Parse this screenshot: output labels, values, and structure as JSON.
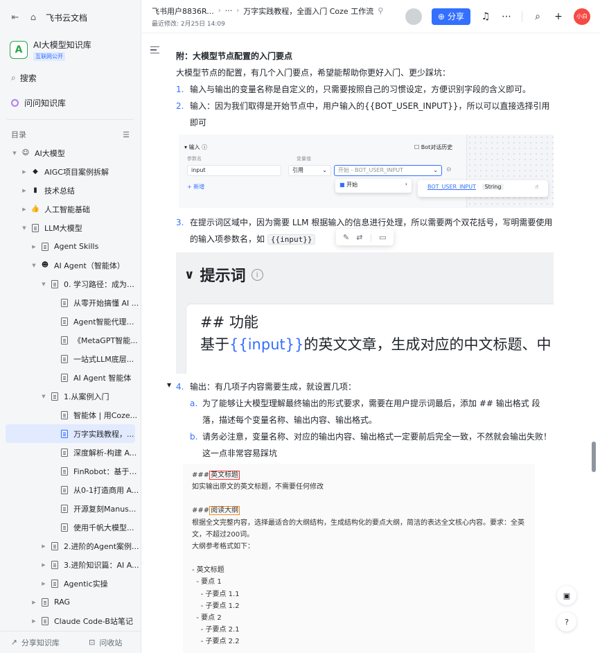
{
  "sidebar": {
    "brand": "飞书云文档",
    "kb_name": "AI大模型知识库",
    "kb_badge": "互联网公开",
    "search": "搜索",
    "ask": "问问知识库",
    "toc_label": "目录",
    "tree": [
      {
        "label": "AI大模型",
        "indent": 0,
        "arrow": "▼",
        "icon": "smile"
      },
      {
        "label": "AIGC项目案例拆解",
        "indent": 1,
        "arrow": "▶",
        "icon": "cube"
      },
      {
        "label": "技术总结",
        "indent": 1,
        "arrow": "▶",
        "icon": "phone"
      },
      {
        "label": "人工智能基础",
        "indent": 1,
        "arrow": "▶",
        "icon": "thumb"
      },
      {
        "label": "LLM大模型",
        "indent": 1,
        "arrow": "▼",
        "icon": "doc"
      },
      {
        "label": "Agent Skills",
        "indent": 2,
        "arrow": "▶",
        "icon": "doc"
      },
      {
        "label": "AI Agent（智能体）",
        "indent": 2,
        "arrow": "▼",
        "icon": "robot"
      },
      {
        "label": "0. 学习路径：成为基...",
        "indent": 3,
        "arrow": "▼",
        "icon": "doc"
      },
      {
        "label": "从零开始搞懂 AI ...",
        "indent": 4,
        "arrow": "",
        "icon": "doc"
      },
      {
        "label": "Agent智能代理开...",
        "indent": 4,
        "arrow": "",
        "icon": "doc"
      },
      {
        "label": "《MetaGPT智能...",
        "indent": 4,
        "arrow": "",
        "icon": "doc"
      },
      {
        "label": "一站式LLM底层...",
        "indent": 4,
        "arrow": "",
        "icon": "doc"
      },
      {
        "label": "AI Agent 智能体",
        "indent": 4,
        "arrow": "",
        "icon": "doc"
      },
      {
        "label": "1.从案例入门",
        "indent": 3,
        "arrow": "▼",
        "icon": "doc"
      },
      {
        "label": "智能体 | 用Coze...",
        "indent": 4,
        "arrow": "",
        "icon": "doc"
      },
      {
        "label": "万字实践教程，...",
        "indent": 4,
        "arrow": "",
        "icon": "doc",
        "active": true
      },
      {
        "label": "深度解析-构建 A...",
        "indent": 4,
        "arrow": "",
        "icon": "doc"
      },
      {
        "label": "FinRobot：基于L...",
        "indent": 4,
        "arrow": "",
        "icon": "doc"
      },
      {
        "label": "从0-1打造商用 A...",
        "indent": 4,
        "arrow": "",
        "icon": "doc"
      },
      {
        "label": "开源复刻Manus...",
        "indent": 4,
        "arrow": "",
        "icon": "doc"
      },
      {
        "label": "使用千帆大模型...",
        "indent": 4,
        "arrow": "",
        "icon": "doc"
      },
      {
        "label": "2.进阶的Agent案例...",
        "indent": 3,
        "arrow": "▶",
        "icon": "doc"
      },
      {
        "label": "3.进阶知识篇：AI A...",
        "indent": 3,
        "arrow": "▶",
        "icon": "doc"
      },
      {
        "label": "Agentic实操",
        "indent": 3,
        "arrow": "▶",
        "icon": "doc"
      },
      {
        "label": "RAG",
        "indent": 2,
        "arrow": "▶",
        "icon": "doc"
      },
      {
        "label": "Claude Code-B站笔记",
        "indent": 2,
        "arrow": "▶",
        "icon": "doc"
      }
    ],
    "bottom_share": "分享知识库",
    "bottom_robot": "问收站"
  },
  "header": {
    "crumb_user": "飞书用户8836R...",
    "crumb_more": "···",
    "crumb_title": "万字实践教程，全面入门 Coze 工作流",
    "last_modified": "最近修改: 2月25日 14:09",
    "share_label": "分享",
    "user_avatar": "小白"
  },
  "doc": {
    "section_title": "附：大模型节点配置的入门要点",
    "intro": "大模型节点的配置，有几个入门要点，希望能帮助你更好入门、更少踩坑：",
    "items": [
      {
        "num": "1.",
        "text": "输入与输出的变量名称是自定义的，只需要按照自己的习惯设定，方便识别字段的含义即可。"
      },
      {
        "num": "2.",
        "text": "输入：因为我们取得是开始节点中，用户输入的{{BOT_USER_INPUT}}，所以可以直接选择引用即可"
      },
      {
        "num": "3.",
        "text_a": "在提示词区域中，因为需要 LLM 根据输入的信息进行处理，所以需要两个双花括号，写明需要使用的输入项参数名，如",
        "code": "{{input}}"
      },
      {
        "num": "4.",
        "text": "输出：有几项子内容需要生成，就设置几项："
      }
    ],
    "sub_items": [
      {
        "num": "a.",
        "text": "为了能够让大模型理解最终输出的形式要求，需要在用户提示词最后，添加 ## 输出格式 段落，描述每个变量名称、输出内容、输出格式。"
      },
      {
        "num": "b.",
        "text": "请务必注意，变量名称、对应的输出内容、输出格式一定要前后完全一致，不然就会输出失败！这一点非常容易踩坑"
      }
    ]
  },
  "img1": {
    "section": "输入",
    "bot_history": "Bot对话历史",
    "col_param": "参数名",
    "col_value": "变量值",
    "param": "input",
    "ref": "引用",
    "value": "开始 - BOT_USER_INPUT",
    "add": "+ 新增",
    "start": "开始",
    "var": "BOT_USER_INPUT",
    "type": "String"
  },
  "img2": {
    "title": "提示词",
    "h": "## 功能",
    "line_pre": "基于",
    "line_var": "{{input}}",
    "line_post": "的英文文章，生成对应的中文标题、中"
  },
  "img3": {
    "l1_pre": "###",
    "l1_hl": "英文标题",
    "l2": "如实输出原文的英文标题，不需要任何修改",
    "l3_pre": "###",
    "l3_hl": "阅读大纲",
    "l4": "根据全文完整内容，选择最适合的大纲结构，生成结构化的要点大纲，简洁的表达全文核心内容。要求：全英文，不超过200词。",
    "l5": "大纲参考格式如下：",
    "outline": [
      "- 英文标题",
      "  - 要点 1",
      "    - 子要点 1.1",
      "    - 子要点 1.2",
      "  - 要点 2",
      "    - 子要点 2.1",
      "    - 子要点 2.2"
    ]
  },
  "colors": {
    "accent": "#3370ff",
    "active_bg": "#e1eaff",
    "highlight_red": "#ee3333",
    "highlight_orange": "#f08a1c"
  }
}
